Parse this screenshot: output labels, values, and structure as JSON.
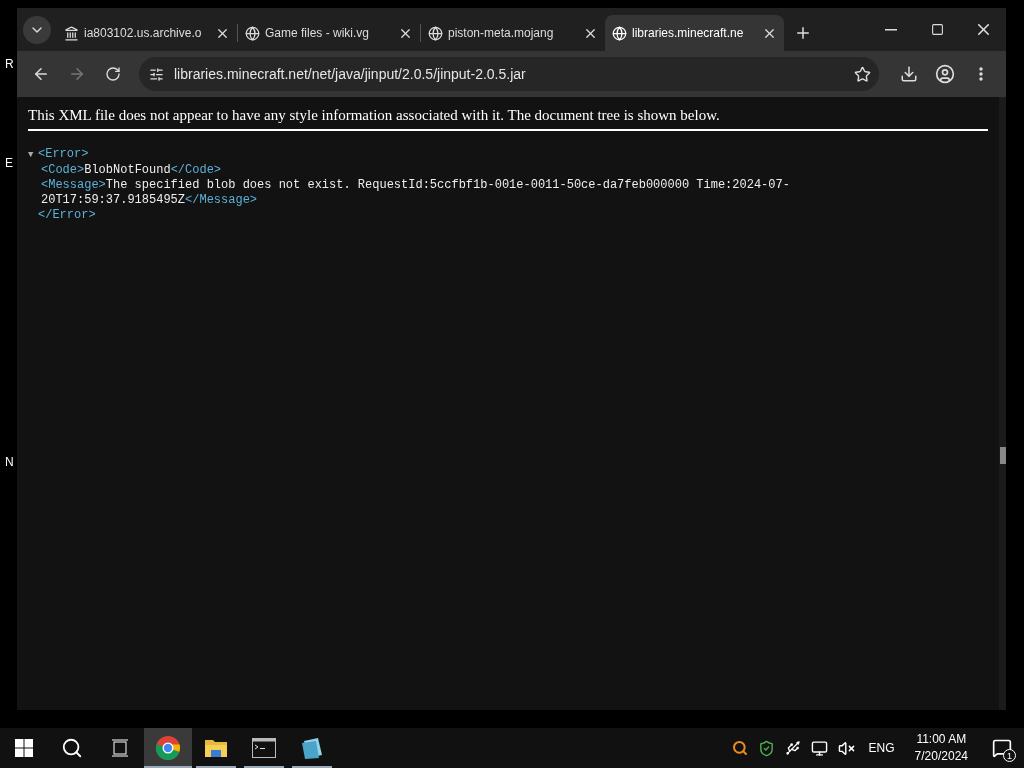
{
  "desktop": {
    "labels": [
      "R",
      "E",
      "N"
    ]
  },
  "browser": {
    "tabs": [
      {
        "title": "ia803102.us.archive.o",
        "kind": "archive",
        "selected": false
      },
      {
        "title": "Game files - wiki.vg",
        "kind": "globe",
        "selected": false
      },
      {
        "title": "piston-meta.mojang",
        "kind": "globe",
        "selected": false
      },
      {
        "title": "libraries.minecraft.ne",
        "kind": "globe",
        "selected": true
      }
    ],
    "address": "libraries.minecraft.net/net/java/jinput/2.0.5/jinput-2.0.5.jar",
    "page": {
      "notice": "This XML file does not appear to have any style information associated with it. The document tree is shown below.",
      "root": {
        "toggle": "▼",
        "open": "<Error>",
        "close": "</Error>",
        "expanded": true,
        "children": [
          {
            "open": "<Code>",
            "text": "BlobNotFound",
            "close": "</Code>"
          },
          {
            "open": "<Message>",
            "text": "The specified blob does not exist. RequestId:5ccfbf1b-001e-0011-50ce-da7feb000000 Time:2024-07-20T17:59:37.9185495Z",
            "close": "</Message>"
          }
        ]
      }
    }
  },
  "taskbar": {
    "apps": [
      {
        "kind": "chrome",
        "selected": true,
        "open": true
      },
      {
        "kind": "folder",
        "selected": false,
        "open": true
      },
      {
        "kind": "terminal",
        "selected": false,
        "open": true
      },
      {
        "kind": "notes",
        "selected": false,
        "open": true
      }
    ],
    "language": "ENG",
    "time": "11:00 AM",
    "date": "7/20/2024",
    "notifications": "1"
  }
}
